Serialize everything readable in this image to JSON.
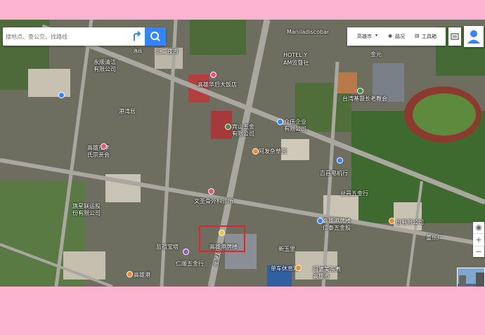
{
  "search": {
    "placeholder": "搜地点、查公交、找路线",
    "route_label": "路线"
  },
  "toolbar": {
    "city": "高雄市",
    "traffic": "路况",
    "tools": "工具箱"
  },
  "map_labels": [
    "汇二夜市",
    "Maniladiscobar",
    "HOTEL Y",
    "AM监督社",
    "金元",
    "台湾基督长老教会",
    "高雄华后大饭店",
    "永顺清洁",
    "有限公司",
    "港湾居",
    "介伟企业",
    "有限公司",
    "宾山五金",
    "有限公司",
    "阿发杂草面",
    "高雄市李",
    "氏宗亲会",
    "吉昌电机行",
    "旗星联运股",
    "份有限公司",
    "益昌五金行",
    "文圣骨外科诊所",
    "高雄港牌楼",
    "仁泰五金股",
    "份有限公司",
    "监祖宝塔",
    "新玉里",
    "重乐厂",
    "仁顺五金行",
    "单车休息站",
    "阿婆美东煮",
    "高雄市",
    "金屋超级",
    "高雄港",
    "汇三特区通风站",
    "金门大"
  ],
  "panorama_label": "全景",
  "highlight_label": "高雄港牌楼",
  "colors": {
    "accent": "#3385ff",
    "highlight": "#e5212c",
    "background": "#fcb3cf"
  },
  "icons": [
    "route-icon",
    "search-icon",
    "chevron-down-icon",
    "traffic-icon",
    "toolbox-icon",
    "layers-icon",
    "user-icon",
    "locate-icon",
    "zoom-in-icon",
    "zoom-out-icon"
  ]
}
